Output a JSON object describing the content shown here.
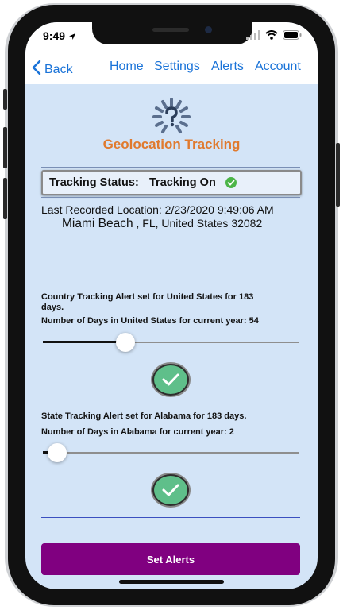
{
  "status_bar": {
    "time": "9:49",
    "location_icon": "location-arrow-icon",
    "signal_icon": "signal-icon",
    "wifi_icon": "wifi-icon",
    "battery_icon": "battery-icon"
  },
  "nav": {
    "back_label": "Back",
    "links": [
      "Home",
      "Settings",
      "Alerts",
      "Account"
    ],
    "accent": "#1a73d8"
  },
  "header": {
    "title": "Geolocation Tracking",
    "title_color": "#e07a2e",
    "logo_icon": "geolocation-logo-icon"
  },
  "tracking": {
    "status_label": "Tracking Status:",
    "status_value": "Tracking On",
    "status_icon": "check-circle-icon",
    "status_color": "#4cb548"
  },
  "location": {
    "prefix": "Last Recorded Location: 2/23/2020 9:49:06 AM",
    "city": "Miami Beach",
    "suffix": ", FL, United States 32082"
  },
  "country_alert": {
    "text": "Country Tracking Alert set for United States for 183 days.",
    "days_text": "Number of Days in United States for current year: 54",
    "slider_fraction": 0.31,
    "confirm_icon": "check-circle-icon"
  },
  "state_alert": {
    "text": "State Tracking Alert set for Alabama for 183 days.",
    "days_text": "Number of Days in Alabama for current year: 2",
    "slider_fraction": 0.02,
    "confirm_icon": "check-circle-icon"
  },
  "actions": {
    "set_alerts_label": "Set Alerts",
    "button_color": "#800080"
  }
}
